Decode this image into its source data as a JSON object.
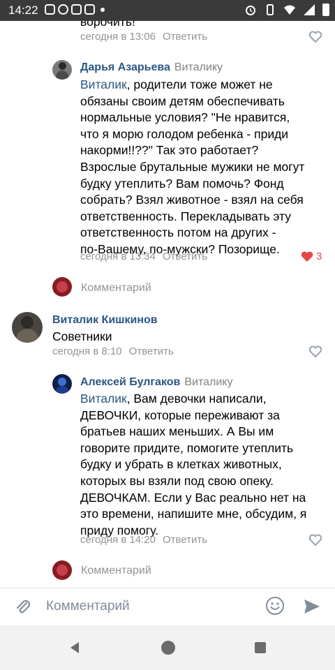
{
  "status_bar": {
    "time": "14:22"
  },
  "thread": {
    "top_cut_text": "ворочить!",
    "top_meta": {
      "timestamp": "сегодня в 13:06",
      "reply_label": "Ответить"
    },
    "comments": [
      {
        "author": "Дарья Азарьева",
        "addressee": "Виталику",
        "mention": "Виталик",
        "text_lines": [
          ", родители тоже может не",
          "обязаны своим детям обеспечивать",
          "нормальные условия? \"Не нравится,",
          "что я морю голодом ребенка - приди",
          "накорми!!??\" Так это работает?",
          "Взрослые брутальные мужики не могут",
          "будку утеплить? Вам помочь? Фонд",
          "собрать? Взял животное - взял на себя",
          "ответственность. Перекладывать эту",
          "ответственность потом на других -",
          "по-Вашему, по-мужски? Позорище."
        ],
        "timestamp": "сегодня в 13:34",
        "reply_label": "Ответить",
        "likes": "3"
      },
      {
        "author": "Виталик Кишкинов",
        "text": "Советники",
        "timestamp": "сегодня в 8:10",
        "reply_label": "Ответить"
      },
      {
        "author": "Алексей Булгаков",
        "addressee": "Виталику",
        "mention": "Виталик",
        "text_lines": [
          ", Вам девочки написали,",
          "ДЕВОЧКИ, которые переживают за",
          "братьев наших меньших. А Вы им",
          "говорите придите, помогите утеплить",
          "будку и убрать в клетках животных,",
          "которых вы взяли под свою опеку.",
          "ДЕВОЧКАМ. Если у Вас реально нет на",
          "это времени, напишите мне, обсудим, я",
          "приду помогу."
        ],
        "timestamp": "сегодня в 14:20",
        "reply_label": "Ответить"
      }
    ],
    "comment_prompt": "Комментарий"
  },
  "composer": {
    "placeholder": "Комментарий"
  },
  "colors": {
    "link": "#2a5885",
    "meta": "#939393",
    "like_active": "#e64646"
  }
}
